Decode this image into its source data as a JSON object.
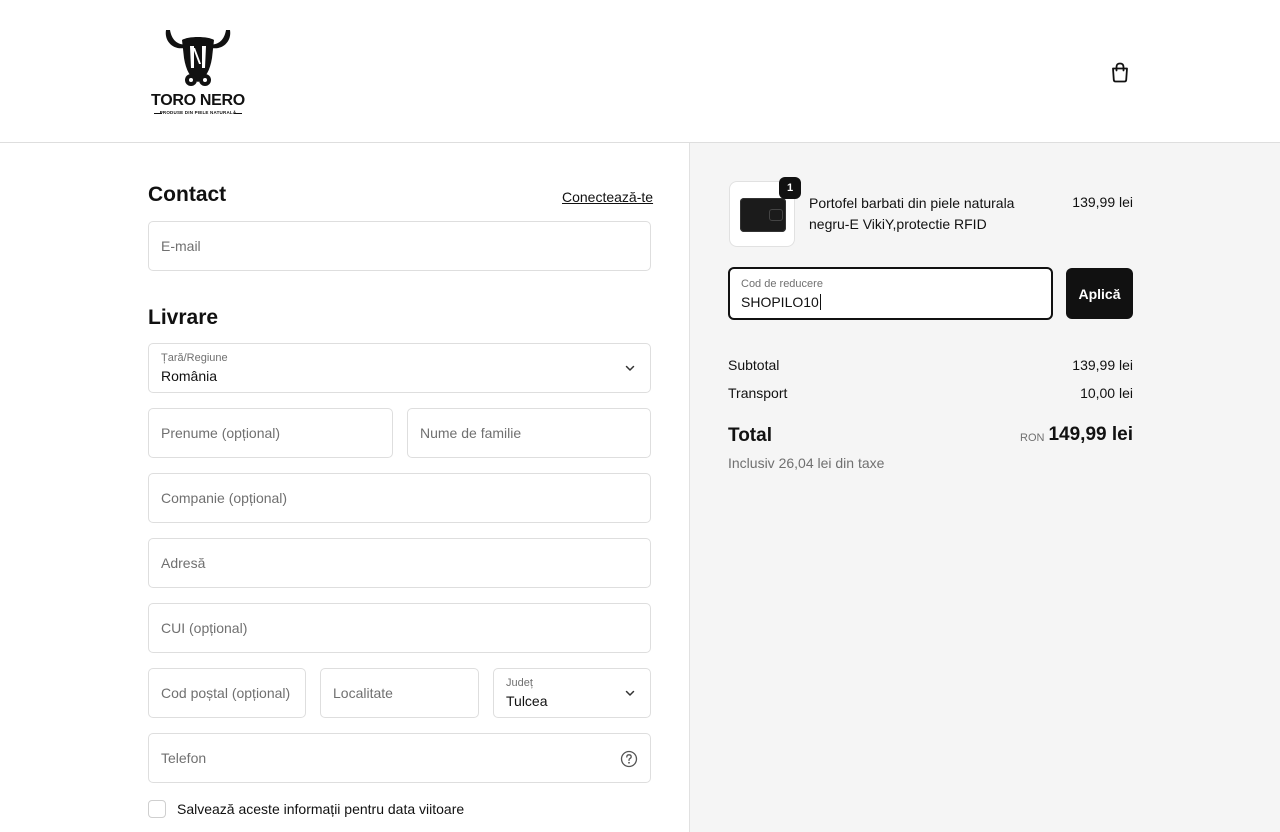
{
  "brand": {
    "name": "TORO NERO",
    "tagline": "PRODUSE DIN PIELE NATURALĂ",
    "logo_icon": "bull-head-logo"
  },
  "header": {
    "cart_icon": "shopping-bag-icon"
  },
  "contact": {
    "title": "Contact",
    "login_link": "Conectează-te",
    "email_placeholder": "E-mail"
  },
  "delivery": {
    "title": "Livrare",
    "country_label": "Țară/Regiune",
    "country_value": "România",
    "first_name_placeholder": "Prenume (opțional)",
    "last_name_placeholder": "Nume de familie",
    "company_placeholder": "Companie (opțional)",
    "address_placeholder": "Adresă",
    "cui_placeholder": "CUI (opțional)",
    "postal_placeholder": "Cod poștal (opțional)",
    "city_placeholder": "Localitate",
    "county_label": "Județ",
    "county_value": "Tulcea",
    "phone_placeholder": "Telefon",
    "save_info_label": "Salvează aceste informații pentru data viitoare"
  },
  "order": {
    "item": {
      "quantity": "1",
      "name": "Portofel barbati din piele naturala negru-E VikiY,protectie RFID",
      "price": "139,99 lei"
    },
    "discount": {
      "label": "Cod de reducere",
      "value": "SHOPILO10",
      "apply_label": "Aplică"
    },
    "subtotal_label": "Subtotal",
    "subtotal_value": "139,99 lei",
    "shipping_label": "Transport",
    "shipping_value": "10,00 lei",
    "total_label": "Total",
    "total_currency": "RON",
    "total_value": "149,99 lei",
    "tax_note": "Inclusiv 26,04 lei din taxe"
  }
}
